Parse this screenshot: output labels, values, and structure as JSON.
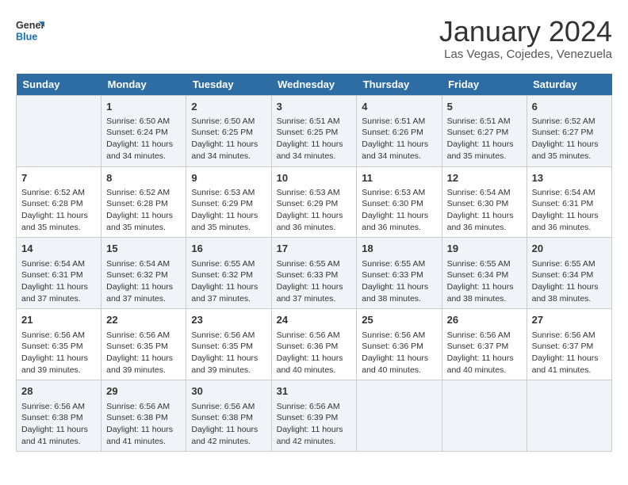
{
  "header": {
    "logo_line1": "General",
    "logo_line2": "Blue",
    "month_title": "January 2024",
    "subtitle": "Las Vegas, Cojedes, Venezuela"
  },
  "days_of_week": [
    "Sunday",
    "Monday",
    "Tuesday",
    "Wednesday",
    "Thursday",
    "Friday",
    "Saturday"
  ],
  "weeks": [
    [
      {
        "day": "",
        "info": ""
      },
      {
        "day": "1",
        "info": "Sunrise: 6:50 AM\nSunset: 6:24 PM\nDaylight: 11 hours and 34 minutes."
      },
      {
        "day": "2",
        "info": "Sunrise: 6:50 AM\nSunset: 6:25 PM\nDaylight: 11 hours and 34 minutes."
      },
      {
        "day": "3",
        "info": "Sunrise: 6:51 AM\nSunset: 6:25 PM\nDaylight: 11 hours and 34 minutes."
      },
      {
        "day": "4",
        "info": "Sunrise: 6:51 AM\nSunset: 6:26 PM\nDaylight: 11 hours and 34 minutes."
      },
      {
        "day": "5",
        "info": "Sunrise: 6:51 AM\nSunset: 6:27 PM\nDaylight: 11 hours and 35 minutes."
      },
      {
        "day": "6",
        "info": "Sunrise: 6:52 AM\nSunset: 6:27 PM\nDaylight: 11 hours and 35 minutes."
      }
    ],
    [
      {
        "day": "7",
        "info": "Sunrise: 6:52 AM\nSunset: 6:28 PM\nDaylight: 11 hours and 35 minutes."
      },
      {
        "day": "8",
        "info": "Sunrise: 6:52 AM\nSunset: 6:28 PM\nDaylight: 11 hours and 35 minutes."
      },
      {
        "day": "9",
        "info": "Sunrise: 6:53 AM\nSunset: 6:29 PM\nDaylight: 11 hours and 35 minutes."
      },
      {
        "day": "10",
        "info": "Sunrise: 6:53 AM\nSunset: 6:29 PM\nDaylight: 11 hours and 36 minutes."
      },
      {
        "day": "11",
        "info": "Sunrise: 6:53 AM\nSunset: 6:30 PM\nDaylight: 11 hours and 36 minutes."
      },
      {
        "day": "12",
        "info": "Sunrise: 6:54 AM\nSunset: 6:30 PM\nDaylight: 11 hours and 36 minutes."
      },
      {
        "day": "13",
        "info": "Sunrise: 6:54 AM\nSunset: 6:31 PM\nDaylight: 11 hours and 36 minutes."
      }
    ],
    [
      {
        "day": "14",
        "info": "Sunrise: 6:54 AM\nSunset: 6:31 PM\nDaylight: 11 hours and 37 minutes."
      },
      {
        "day": "15",
        "info": "Sunrise: 6:54 AM\nSunset: 6:32 PM\nDaylight: 11 hours and 37 minutes."
      },
      {
        "day": "16",
        "info": "Sunrise: 6:55 AM\nSunset: 6:32 PM\nDaylight: 11 hours and 37 minutes."
      },
      {
        "day": "17",
        "info": "Sunrise: 6:55 AM\nSunset: 6:33 PM\nDaylight: 11 hours and 37 minutes."
      },
      {
        "day": "18",
        "info": "Sunrise: 6:55 AM\nSunset: 6:33 PM\nDaylight: 11 hours and 38 minutes."
      },
      {
        "day": "19",
        "info": "Sunrise: 6:55 AM\nSunset: 6:34 PM\nDaylight: 11 hours and 38 minutes."
      },
      {
        "day": "20",
        "info": "Sunrise: 6:55 AM\nSunset: 6:34 PM\nDaylight: 11 hours and 38 minutes."
      }
    ],
    [
      {
        "day": "21",
        "info": "Sunrise: 6:56 AM\nSunset: 6:35 PM\nDaylight: 11 hours and 39 minutes."
      },
      {
        "day": "22",
        "info": "Sunrise: 6:56 AM\nSunset: 6:35 PM\nDaylight: 11 hours and 39 minutes."
      },
      {
        "day": "23",
        "info": "Sunrise: 6:56 AM\nSunset: 6:35 PM\nDaylight: 11 hours and 39 minutes."
      },
      {
        "day": "24",
        "info": "Sunrise: 6:56 AM\nSunset: 6:36 PM\nDaylight: 11 hours and 40 minutes."
      },
      {
        "day": "25",
        "info": "Sunrise: 6:56 AM\nSunset: 6:36 PM\nDaylight: 11 hours and 40 minutes."
      },
      {
        "day": "26",
        "info": "Sunrise: 6:56 AM\nSunset: 6:37 PM\nDaylight: 11 hours and 40 minutes."
      },
      {
        "day": "27",
        "info": "Sunrise: 6:56 AM\nSunset: 6:37 PM\nDaylight: 11 hours and 41 minutes."
      }
    ],
    [
      {
        "day": "28",
        "info": "Sunrise: 6:56 AM\nSunset: 6:38 PM\nDaylight: 11 hours and 41 minutes."
      },
      {
        "day": "29",
        "info": "Sunrise: 6:56 AM\nSunset: 6:38 PM\nDaylight: 11 hours and 41 minutes."
      },
      {
        "day": "30",
        "info": "Sunrise: 6:56 AM\nSunset: 6:38 PM\nDaylight: 11 hours and 42 minutes."
      },
      {
        "day": "31",
        "info": "Sunrise: 6:56 AM\nSunset: 6:39 PM\nDaylight: 11 hours and 42 minutes."
      },
      {
        "day": "",
        "info": ""
      },
      {
        "day": "",
        "info": ""
      },
      {
        "day": "",
        "info": ""
      }
    ]
  ]
}
